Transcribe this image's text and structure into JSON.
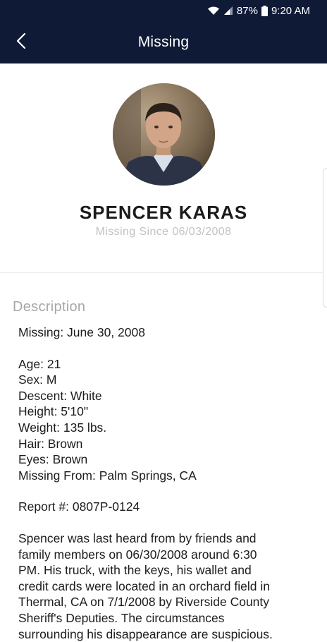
{
  "status_bar": {
    "battery": "87%",
    "time": "9:20 AM",
    "icons": [
      "wifi-icon",
      "signal-icon",
      "battery-icon"
    ]
  },
  "app_bar": {
    "title": "Missing",
    "back_icon": "back-arrow-icon"
  },
  "profile": {
    "name": "SPENCER KARAS",
    "missing_since": "Missing Since 06/03/2008"
  },
  "description": {
    "heading": "Description",
    "missing_date": "Missing: June 30, 2008",
    "details": [
      "Age: 21",
      "Sex: M",
      "Descent: White",
      "Height: 5'10\"",
      "Weight: 135 lbs.",
      "Hair: Brown",
      "Eyes: Brown",
      "Missing From: Palm Springs, CA"
    ],
    "report": "Report #: 0807P-0124",
    "narrative": [
      "Spencer was last heard from by friends and",
      "family members on 06/30/2008 around 6:30",
      "PM. His truck, with the keys, his wallet and",
      "credit cards were located in an orchard field in",
      "Thermal, CA on 7/1/2008 by Riverside County",
      "Sheriff's Deputies. The circumstances",
      "surrounding his disappearance are suspicious."
    ]
  },
  "colors": {
    "app_bar": "#0f1a36",
    "secondary_text": "#a7a7a7"
  }
}
